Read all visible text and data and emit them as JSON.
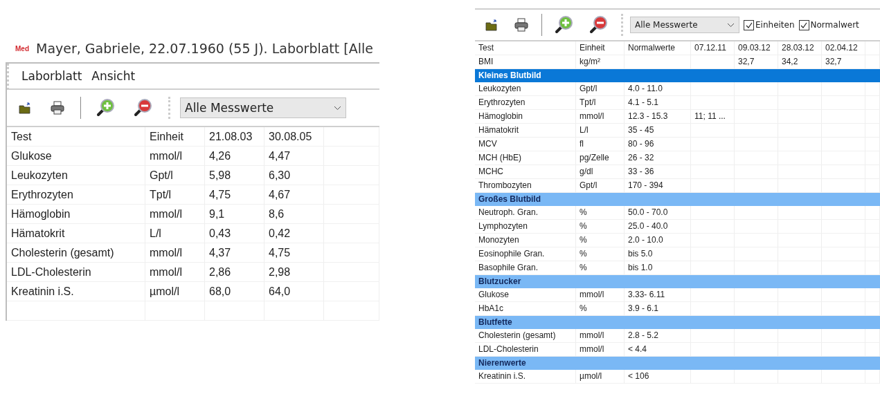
{
  "left_window": {
    "title_badge": "Med",
    "title": "Mayer, Gabriele,  22.07.1960 (55 J). Laborblatt  [Alle",
    "menu": [
      "Laborblatt",
      "Ansicht"
    ],
    "toolbar": {
      "filter": "Alle Messwerte"
    },
    "table": {
      "columns": [
        "Test",
        "Einheit",
        "21.08.03",
        "30.08.05"
      ],
      "rows": [
        {
          "cells": [
            "Glukose",
            "mmol/l",
            "4,26",
            "4,47"
          ]
        },
        {
          "cells": [
            "Leukozyten",
            "Gpt/l",
            "5,98",
            "6,30"
          ]
        },
        {
          "cells": [
            "Erythrozyten",
            "Tpt/l",
            "4,75",
            "4,67"
          ]
        },
        {
          "cells": [
            "Hämoglobin",
            "mmol/l",
            "9,1",
            "8,6"
          ]
        },
        {
          "cells": [
            "Hämatokrit",
            "L/l",
            "0,43",
            "0,42"
          ]
        },
        {
          "cells": [
            "Cholesterin (gesamt)",
            "mmol/l",
            "4,37",
            "4,75"
          ]
        },
        {
          "cells": [
            "LDL-Cholesterin",
            "mmol/l",
            "2,86",
            "2,98"
          ]
        },
        {
          "cells": [
            "Kreatinin i.S.",
            "µmol/l",
            "68,0",
            "64,0"
          ]
        }
      ]
    }
  },
  "right_window": {
    "toolbar": {
      "filter": "Alle Messwerte",
      "checkboxes": [
        {
          "label": "Einheiten",
          "checked": true
        },
        {
          "label": "Normalwert",
          "checked": true
        }
      ]
    },
    "table": {
      "columns": [
        "Test",
        "Einheit",
        "Normalwerte",
        "07.12.11",
        "09.03.12",
        "28.03.12",
        "02.04.12"
      ],
      "rows": [
        {
          "kind": "data",
          "cells": [
            "BMI",
            "kg/m²",
            "",
            "",
            "32,7",
            "34,2",
            "32,7"
          ]
        },
        {
          "kind": "group",
          "selected": true,
          "cells": [
            "Kleines Blutbild"
          ]
        },
        {
          "kind": "data",
          "cells": [
            "Leukozyten",
            "Gpt/l",
            "4.0 - 11.0",
            "",
            "",
            "",
            ""
          ]
        },
        {
          "kind": "data",
          "cells": [
            "Erythrozyten",
            "Tpt/l",
            "4.1 - 5.1",
            "",
            "",
            "",
            ""
          ]
        },
        {
          "kind": "data",
          "cells": [
            "Hämoglobin",
            "mmol/l",
            "12.3 - 15.3",
            "11; 11 ...",
            "",
            "",
            ""
          ]
        },
        {
          "kind": "data",
          "cells": [
            "Hämatokrit",
            "L/l",
            "35 - 45",
            "",
            "",
            "",
            ""
          ]
        },
        {
          "kind": "data",
          "cells": [
            "MCV",
            "fl",
            "80 - 96",
            "",
            "",
            "",
            ""
          ]
        },
        {
          "kind": "data",
          "cells": [
            "MCH (HbE)",
            "pg/Zelle",
            "26 - 32",
            "",
            "",
            "",
            ""
          ]
        },
        {
          "kind": "data",
          "cells": [
            "MCHC",
            "g/dl",
            "33 - 36",
            "",
            "",
            "",
            ""
          ]
        },
        {
          "kind": "data",
          "cells": [
            "Thrombozyten",
            "Gpt/l",
            "170 - 394",
            "",
            "",
            "",
            ""
          ]
        },
        {
          "kind": "group",
          "selected": false,
          "cells": [
            "Großes Blutbild"
          ]
        },
        {
          "kind": "data",
          "cells": [
            "Neutroph. Gran.",
            "%",
            "50.0 - 70.0",
            "",
            "",
            "",
            ""
          ]
        },
        {
          "kind": "data",
          "cells": [
            "Lymphozyten",
            "%",
            "25.0 - 40.0",
            "",
            "",
            "",
            ""
          ]
        },
        {
          "kind": "data",
          "cells": [
            "Monozyten",
            "%",
            "2.0 - 10.0",
            "",
            "",
            "",
            ""
          ]
        },
        {
          "kind": "data",
          "cells": [
            "Eosinophile Gran.",
            "%",
            "bis 5.0",
            "",
            "",
            "",
            ""
          ]
        },
        {
          "kind": "data",
          "cells": [
            "Basophile Gran.",
            "%",
            "bis 1.0",
            "",
            "",
            "",
            ""
          ]
        },
        {
          "kind": "group",
          "selected": false,
          "cells": [
            "Blutzucker"
          ]
        },
        {
          "kind": "data",
          "cells": [
            "Glukose",
            "mmol/l",
            "3.33- 6.11",
            "",
            "",
            "",
            ""
          ]
        },
        {
          "kind": "data",
          "cells": [
            "HbA1c",
            "%",
            "3.9 - 6.1",
            "",
            "",
            "",
            ""
          ]
        },
        {
          "kind": "group",
          "selected": false,
          "cells": [
            "Blutfette"
          ]
        },
        {
          "kind": "data",
          "cells": [
            "Cholesterin (gesamt)",
            "mmol/l",
            "2.8 - 5.2",
            "",
            "",
            "",
            ""
          ]
        },
        {
          "kind": "data",
          "cells": [
            "LDL-Cholesterin",
            "mmol/l",
            "< 4.4",
            "",
            "",
            "",
            ""
          ]
        },
        {
          "kind": "group",
          "selected": false,
          "cells": [
            "Nierenwerte"
          ]
        },
        {
          "kind": "data",
          "cells": [
            "Kreatinin i.S.",
            "µmol/l",
            "< 106",
            "",
            "",
            "",
            ""
          ]
        }
      ]
    }
  }
}
